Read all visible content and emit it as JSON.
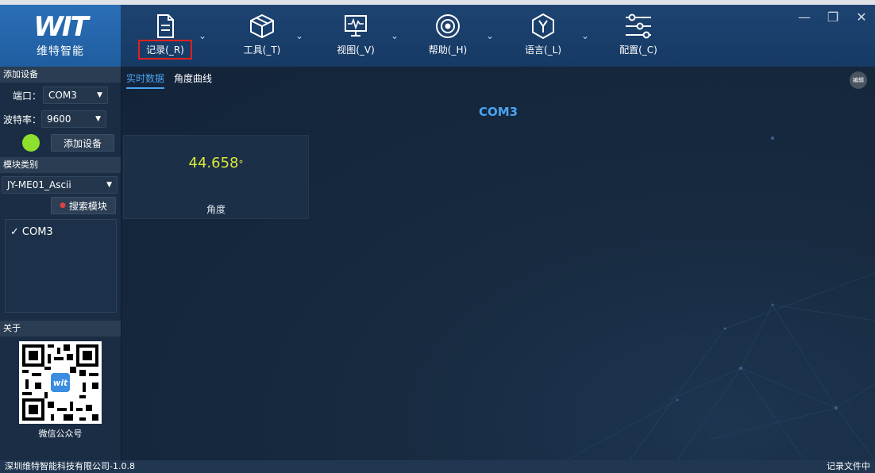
{
  "app": {
    "logo_mark": "WIT",
    "logo_text": "维特智能"
  },
  "toolbar": {
    "items": [
      {
        "label": "记录(_R)",
        "icon": "document-icon",
        "selected": true
      },
      {
        "label": "工具(_T)",
        "icon": "cube-icon"
      },
      {
        "label": "视图(_V)",
        "icon": "monitor-waveform-icon"
      },
      {
        "label": "帮助(_H)",
        "icon": "target-icon"
      },
      {
        "label": "语言(_L)",
        "icon": "hexagon-y-icon"
      },
      {
        "label": "配置(_C)",
        "icon": "sliders-icon"
      }
    ],
    "caret": "⌄",
    "window_buttons": {
      "minimize": "—",
      "maximize": "❐",
      "close": "✕"
    }
  },
  "sidebar": {
    "add_device": {
      "header": "添加设备",
      "port_label": "端口：",
      "port_value": "COM3",
      "baud_label": "波特率：",
      "baud_value": "9600",
      "status_color": "#8fe02e",
      "add_button": "添加设备"
    },
    "module_type": {
      "header": "模块类别",
      "selected_module": "JY-ME01_Ascii",
      "search_button": "搜索模块",
      "devices": [
        {
          "check": "✓",
          "name": "COM3"
        }
      ]
    },
    "about": {
      "header": "关于",
      "qr_caption": "微信公众号"
    }
  },
  "main": {
    "tabs": [
      {
        "label": "实时数据",
        "active": true
      },
      {
        "label": "角度曲线",
        "active": false
      }
    ],
    "edit_button": "编辑",
    "port_title": "COM3",
    "card": {
      "value": "44.658",
      "unit": "°",
      "label": "角度"
    }
  },
  "statusbar": {
    "left": "深圳维特智能科技有限公司-1.0.8",
    "right": "记录文件中"
  },
  "colors": {
    "accent_blue": "#4aa3f0",
    "value_yellow": "#d9e83a",
    "selected_outline": "#e02020"
  }
}
